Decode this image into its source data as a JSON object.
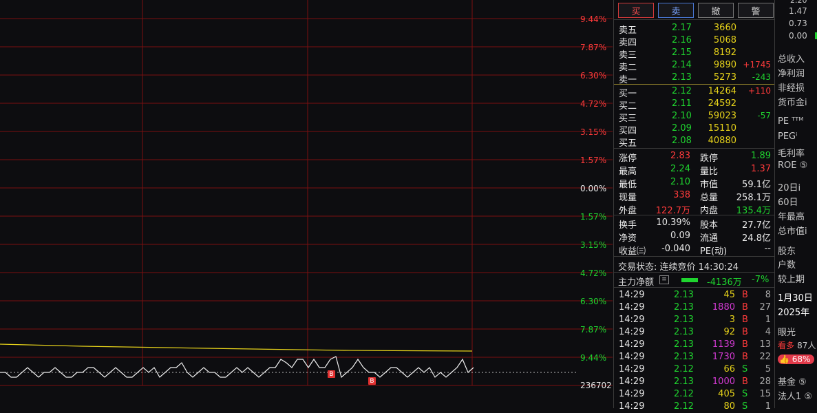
{
  "chart": {
    "pct_labels": [
      {
        "text": "9.44%",
        "tone": "red"
      },
      {
        "text": "7.87%",
        "tone": "red"
      },
      {
        "text": "6.30%",
        "tone": "red"
      },
      {
        "text": "4.72%",
        "tone": "red"
      },
      {
        "text": "3.15%",
        "tone": "red"
      },
      {
        "text": "1.57%",
        "tone": "red"
      },
      {
        "text": "0.00%",
        "tone": "white"
      },
      {
        "text": "1.57%",
        "tone": "green"
      },
      {
        "text": "3.15%",
        "tone": "green"
      },
      {
        "text": "4.72%",
        "tone": "green"
      },
      {
        "text": "6.30%",
        "tone": "green"
      },
      {
        "text": "7.87%",
        "tone": "green"
      },
      {
        "text": "9.44%",
        "tone": "green"
      }
    ],
    "volume_label": "236702",
    "trade_marks": [
      "B",
      "B"
    ]
  },
  "order_buttons": {
    "buy": "买",
    "sell": "卖",
    "cancel": "撤",
    "alert": "警"
  },
  "asks": [
    {
      "label": "卖五",
      "price": "2.17",
      "qty": "3660",
      "chg": ""
    },
    {
      "label": "卖四",
      "price": "2.16",
      "qty": "5068",
      "chg": ""
    },
    {
      "label": "卖三",
      "price": "2.15",
      "qty": "8192",
      "chg": ""
    },
    {
      "label": "卖二",
      "price": "2.14",
      "qty": "9890",
      "chg": "+1745"
    },
    {
      "label": "卖一",
      "price": "2.13",
      "qty": "5273",
      "chg": "-243"
    }
  ],
  "bids": [
    {
      "label": "买一",
      "price": "2.12",
      "qty": "14264",
      "chg": "+110"
    },
    {
      "label": "买二",
      "price": "2.11",
      "qty": "24592",
      "chg": ""
    },
    {
      "label": "买三",
      "price": "2.10",
      "qty": "59023",
      "chg": "-57"
    },
    {
      "label": "买四",
      "price": "2.09",
      "qty": "15110",
      "chg": ""
    },
    {
      "label": "买五",
      "price": "2.08",
      "qty": "40880",
      "chg": ""
    }
  ],
  "stats1": [
    {
      "l1": "涨停",
      "v1": "2.83",
      "l2": "跌停",
      "v2": "1.89"
    },
    {
      "l1": "最高",
      "v1": "2.24",
      "l2": "量比",
      "v2": "1.37"
    },
    {
      "l1": "最低",
      "v1": "2.10",
      "l2": "市值",
      "v2": "59.1亿"
    },
    {
      "l1": "现量",
      "v1": "338",
      "l2": "总量",
      "v2": "258.1万"
    },
    {
      "l1": "外盘",
      "v1": "122.7万",
      "l2": "内盘",
      "v2": "135.4万"
    }
  ],
  "stats2": [
    {
      "l1": "换手",
      "v1": "10.39%",
      "l2": "股本",
      "v2": "27.7亿"
    },
    {
      "l1": "净资",
      "v1": "0.09",
      "l2": "流通",
      "v2": "24.8亿"
    },
    {
      "l1": "收益㈢",
      "v1": "-0.040",
      "l2": "PE(动)",
      "v2": "--"
    }
  ],
  "trade_status": "交易状态: 连续竞价 14:30:24",
  "main_flow": {
    "label": "主力净额",
    "amount": "-4136万",
    "pct": "-7%"
  },
  "ticks": [
    {
      "t": "14:29",
      "p": "2.13",
      "v": "45",
      "vc": "yellow",
      "s": "B",
      "n": "8"
    },
    {
      "t": "14:29",
      "p": "2.13",
      "v": "1880",
      "vc": "magenta",
      "s": "B",
      "n": "27"
    },
    {
      "t": "14:29",
      "p": "2.13",
      "v": "3",
      "vc": "yellow",
      "s": "B",
      "n": "1"
    },
    {
      "t": "14:29",
      "p": "2.13",
      "v": "92",
      "vc": "yellow",
      "s": "B",
      "n": "4"
    },
    {
      "t": "14:29",
      "p": "2.13",
      "v": "1139",
      "vc": "magenta",
      "s": "B",
      "n": "13"
    },
    {
      "t": "14:29",
      "p": "2.13",
      "v": "1730",
      "vc": "magenta",
      "s": "B",
      "n": "22"
    },
    {
      "t": "14:29",
      "p": "2.12",
      "v": "66",
      "vc": "yellow",
      "s": "S",
      "n": "5"
    },
    {
      "t": "14:29",
      "p": "2.13",
      "v": "1000",
      "vc": "magenta",
      "s": "B",
      "n": "28"
    },
    {
      "t": "14:29",
      "p": "2.12",
      "v": "405",
      "vc": "yellow",
      "s": "S",
      "n": "15"
    },
    {
      "t": "14:29",
      "p": "2.12",
      "v": "80",
      "vc": "yellow",
      "s": "S",
      "n": "1"
    }
  ],
  "sidebar": {
    "values": [
      "1.47",
      "0.73",
      "0.00"
    ],
    "items": [
      "总收入",
      "净利润",
      "非经损",
      "货币金i",
      "PE ᵀᵀᴹ",
      "PEGⁱ",
      "毛利率",
      "ROE ⑤",
      "20日i",
      "60日",
      "年最高",
      "总市值i",
      "股东",
      "户数",
      "较上期",
      "1月30日",
      "2025年",
      "眼光",
      "看多 87人",
      "68%",
      "基金 ⑤",
      "法人1 ⑤"
    ]
  }
}
